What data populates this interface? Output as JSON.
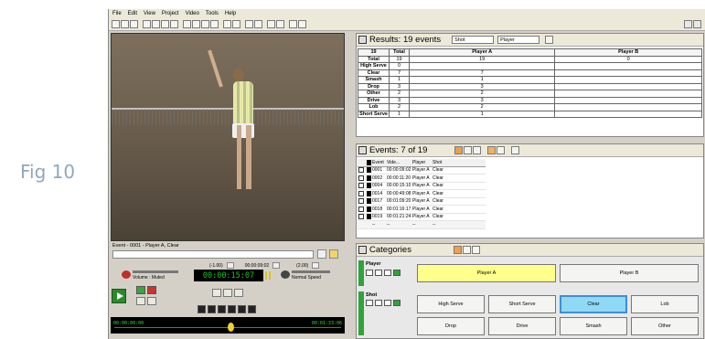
{
  "figure_label": "Fig 10",
  "menu": [
    "File",
    "Edit",
    "View",
    "Project",
    "Video",
    "Tools",
    "Help"
  ],
  "video": {
    "event_caption": "Event - 0001 - Player A, Clear",
    "rate_left": "(-1.00)",
    "clip_time": "00:00:09:02",
    "rate_right": "(2.00)",
    "volume_label": "Volume : Muted",
    "timecode": "00:00:15:07",
    "speed_label": "Normal Speed",
    "timeline_start": "00:00:00:00",
    "timeline_end": "00:01:33:06"
  },
  "results": {
    "title": "Results: 19 events",
    "dropdown_1": "Shot",
    "dropdown_2": "Player",
    "header": [
      "19",
      "Total",
      "Player A",
      "Player B"
    ],
    "rows": [
      {
        "label": "Total",
        "total": "19",
        "a": "19",
        "b": "0"
      },
      {
        "label": "High Serve",
        "total": "0",
        "a": "",
        "b": ""
      },
      {
        "label": "Clear",
        "total": "7",
        "a": "7",
        "b": ""
      },
      {
        "label": "Smash",
        "total": "1",
        "a": "1",
        "b": ""
      },
      {
        "label": "Drop",
        "total": "3",
        "a": "3",
        "b": ""
      },
      {
        "label": "Other",
        "total": "2",
        "a": "2",
        "b": ""
      },
      {
        "label": "Drive",
        "total": "3",
        "a": "3",
        "b": ""
      },
      {
        "label": "Lob",
        "total": "2",
        "a": "2",
        "b": ""
      },
      {
        "label": "Short Serve",
        "total": "1",
        "a": "1",
        "b": ""
      }
    ]
  },
  "events": {
    "title": "Events: 7 of 19",
    "columns": [
      "Event",
      "Vide...",
      "Player",
      "Shot"
    ],
    "rows": [
      {
        "event": "0001",
        "video": "00:00:09:02",
        "player": "Player A",
        "shot": "Clear"
      },
      {
        "event": "0002",
        "video": "00:00:11:20",
        "player": "Player A",
        "shot": "Clear"
      },
      {
        "event": "0004",
        "video": "00:00:15:10",
        "player": "Player A",
        "shot": "Clear"
      },
      {
        "event": "0014",
        "video": "00:00:49:08",
        "player": "Player A",
        "shot": "Clear"
      },
      {
        "event": "0017",
        "video": "00:01:09:20",
        "player": "Player A",
        "shot": "Clear"
      },
      {
        "event": "0018",
        "video": "00:01:16:17",
        "player": "Player A",
        "shot": "Clear"
      },
      {
        "event": "0019",
        "video": "00:01:21:24",
        "player": "Player A",
        "shot": "Clear"
      }
    ],
    "footer": [
      "--",
      "--",
      "--",
      "--"
    ]
  },
  "categories": {
    "title": "Categories",
    "player_group": "Player",
    "player_buttons": [
      "Player A",
      "Player B"
    ],
    "shot_group": "Shot",
    "shot_buttons_row1": [
      "High Serve",
      "Short Serve",
      "Clear",
      "Lob"
    ],
    "shot_buttons_row2": [
      "Drop",
      "Drive",
      "Smash",
      "Other"
    ]
  }
}
